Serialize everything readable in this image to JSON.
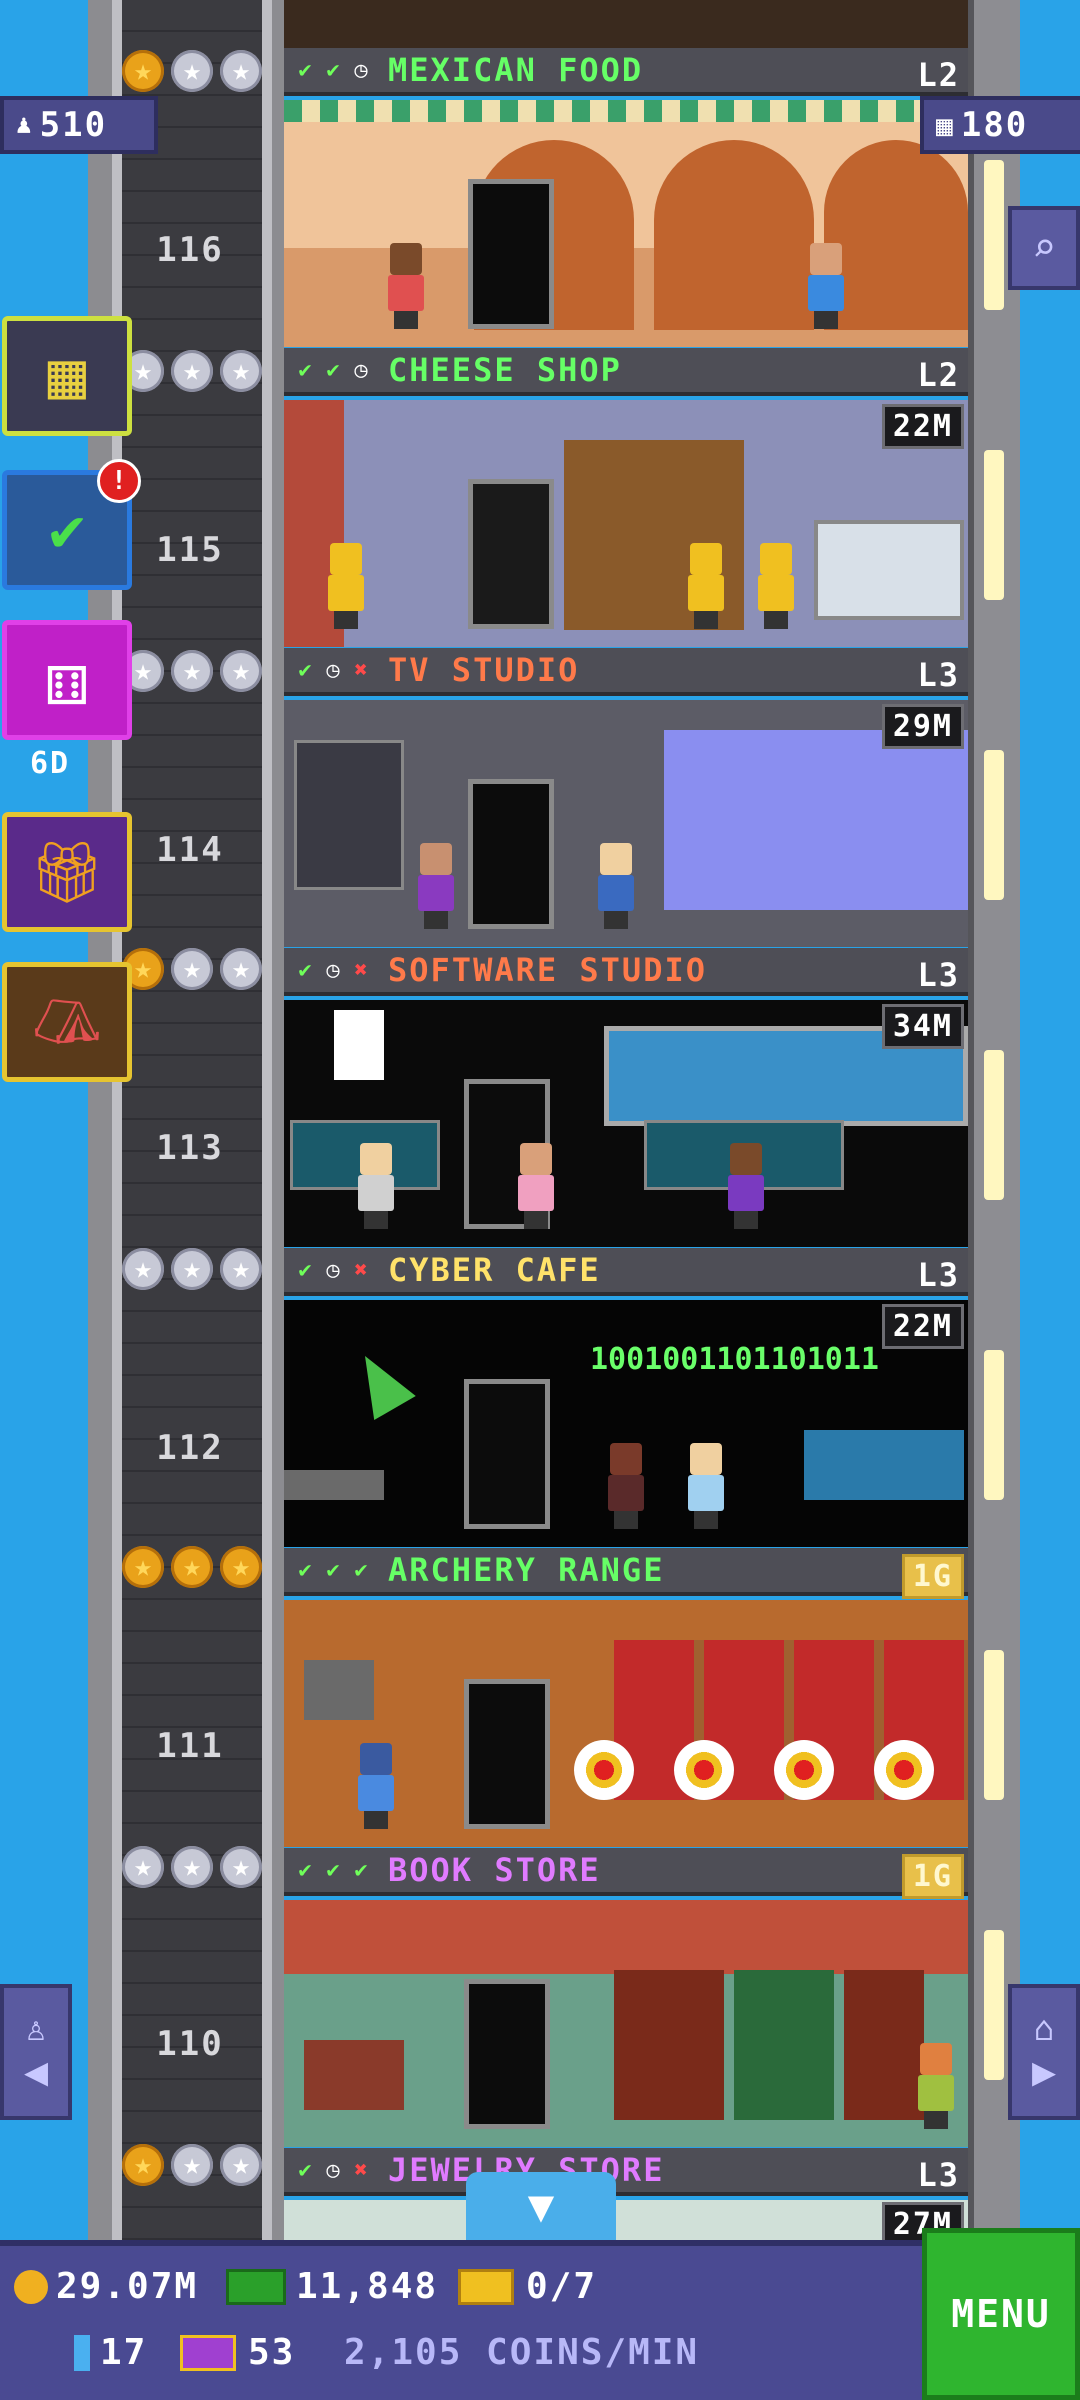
{
  "hud": {
    "population": "510",
    "bux_top": "180"
  },
  "floors": [
    {
      "number": "116",
      "name": "MEXICAN FOOD",
      "level": "L2",
      "status": [
        "done",
        "done",
        "wait"
      ],
      "name_color": "#66ff66",
      "stars": [
        "gold",
        "silver",
        "silver"
      ],
      "cost": ""
    },
    {
      "number": "115",
      "name": "CHEESE SHOP",
      "level": "L2",
      "status": [
        "done",
        "done",
        "wait"
      ],
      "name_color": "#66ff66",
      "stars": [
        "silver",
        "silver",
        "silver"
      ],
      "cost": "22M"
    },
    {
      "number": "114",
      "name": "TV STUDIO",
      "level": "L3",
      "status": [
        "done",
        "wait",
        "fail"
      ],
      "name_color": "#ff7a4a",
      "stars": [
        "silver",
        "silver",
        "silver"
      ],
      "cost": "29M"
    },
    {
      "number": "113",
      "name": "SOFTWARE STUDIO",
      "level": "L3",
      "status": [
        "done",
        "wait",
        "fail"
      ],
      "name_color": "#ff7a4a",
      "stars": [
        "gold",
        "silver",
        "silver"
      ],
      "cost": "34M"
    },
    {
      "number": "112",
      "name": "CYBER CAFE",
      "level": "L3",
      "status": [
        "done",
        "wait",
        "fail"
      ],
      "name_color": "#ffe26a",
      "stars": [
        "silver",
        "silver",
        "silver"
      ],
      "cost": "22M"
    },
    {
      "number": "111",
      "name": "ARCHERY RANGE",
      "level": "1G",
      "status": [
        "done",
        "done",
        "done"
      ],
      "name_color": "#66ff66",
      "stars": [
        "gold",
        "gold",
        "gold"
      ],
      "cost": ""
    },
    {
      "number": "110",
      "name": "BOOK STORE",
      "level": "1G",
      "status": [
        "done",
        "done",
        "done"
      ],
      "name_color": "#e07bff",
      "stars": [
        "silver",
        "silver",
        "silver"
      ],
      "cost": ""
    },
    {
      "number": "",
      "name": "JEWELRY STORE",
      "level": "L3",
      "status": [
        "done",
        "wait",
        "fail"
      ],
      "name_color": "#e07bff",
      "stars": [
        "gold",
        "silver",
        "silver"
      ],
      "cost": "27M"
    }
  ],
  "room_text": {
    "cyber_binary": "1001001101101011"
  },
  "side": {
    "dice_timer": "6D"
  },
  "bottom": {
    "coins": "29.07M",
    "bux": "11,848",
    "tickets": "0/7",
    "keys": "17",
    "vip": "53",
    "rate": "2,105 COINS/MIN",
    "menu_label": "MENU"
  },
  "icons": {
    "check": "✔",
    "clock": "◷",
    "fail": "✖",
    "star": "★"
  }
}
